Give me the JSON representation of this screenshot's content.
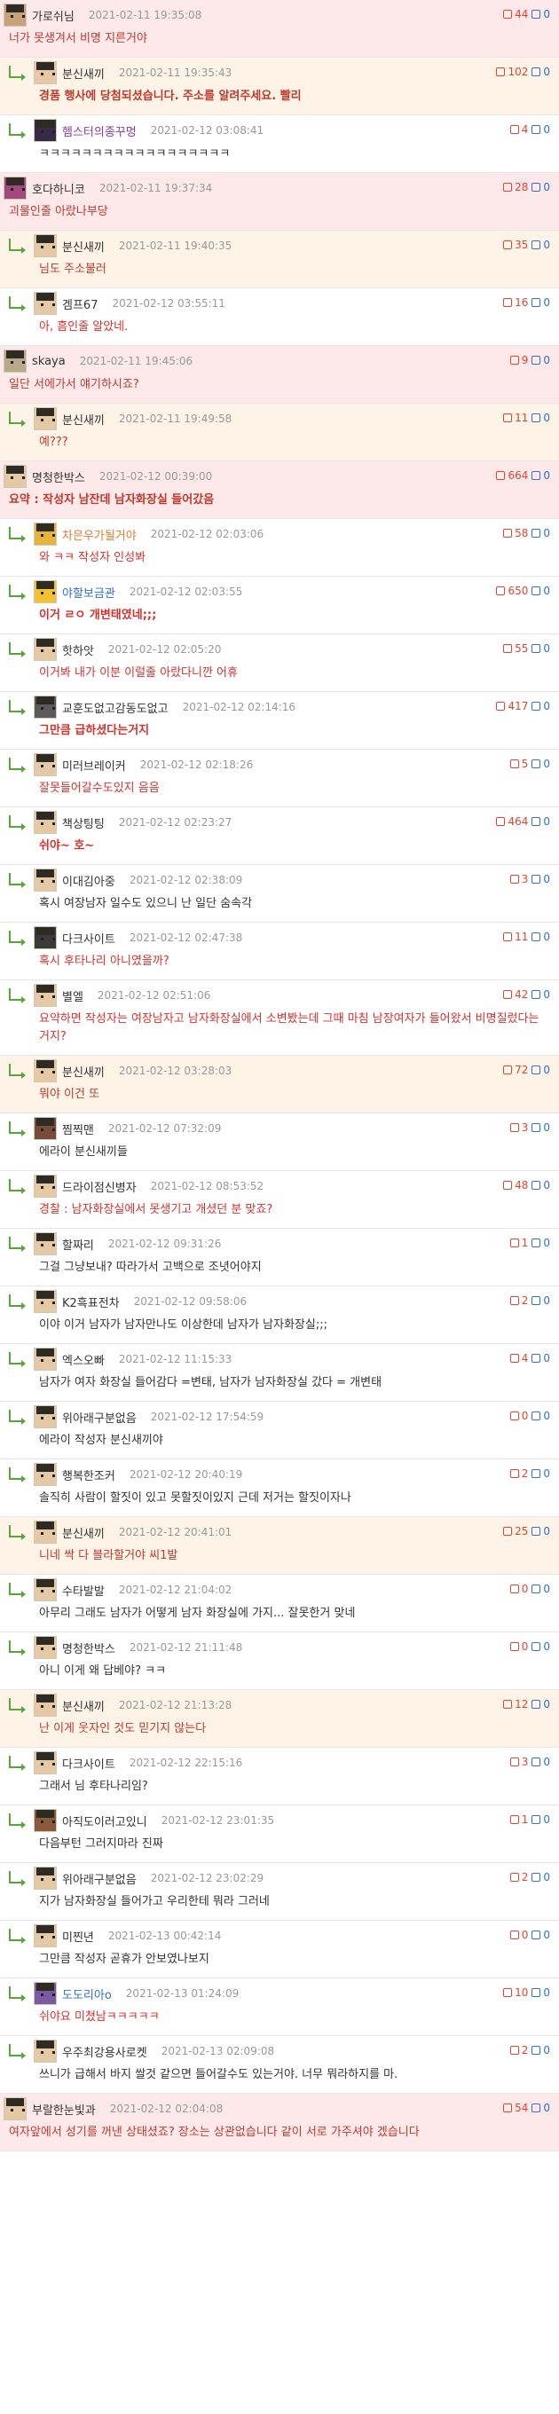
{
  "comments": [
    {
      "type": "best",
      "depth": 0,
      "avatar": "custom",
      "avatar_color": "#c9a27a",
      "nick": "가로쉬님",
      "time": "2021-02-11 19:35:08",
      "up": "44",
      "down": "0",
      "text": "너가 못생겨서 비명 지른거야"
    },
    {
      "type": "author",
      "depth": 1,
      "avatar": "default",
      "nick": "분신새끼",
      "time": "2021-02-11 19:35:43",
      "up": "102",
      "down": "0",
      "text": "경품 행사에 당첨되셨습니다. 주소를 알려주세요. 빨리",
      "bold": true
    },
    {
      "type": "normal",
      "depth": 1,
      "avatar": "custom",
      "avatar_color": "#3a2a4a",
      "nick": "헴스터의종꾸멍",
      "nick_color": "#8b3ba3",
      "time": "2021-02-12 03:08:41",
      "up": "4",
      "down": "0",
      "text": "ㅋㅋㅋㅋㅋㅋㅋㅋㅋㅋㅋㅋㅋㅋㅋㅋㅋㅋ"
    },
    {
      "type": "best",
      "depth": 0,
      "avatar": "custom",
      "avatar_color": "#a3477f",
      "nick": "호다하니코",
      "time": "2021-02-11 19:37:34",
      "up": "28",
      "down": "0",
      "text": "괴물인줄 아랐나부당"
    },
    {
      "type": "author",
      "depth": 1,
      "avatar": "default",
      "nick": "분신새끼",
      "time": "2021-02-11 19:40:35",
      "up": "35",
      "down": "0",
      "text": "님도 주소불러"
    },
    {
      "type": "normal",
      "depth": 1,
      "avatar": "default",
      "nick": "겜프67",
      "time": "2021-02-12 03:55:11",
      "up": "16",
      "down": "0",
      "text": "아, 흠인줄 알았네.",
      "red": true
    },
    {
      "type": "best",
      "depth": 0,
      "avatar": "custom",
      "avatar_color": "#b8a98a",
      "nick": "skaya",
      "time": "2021-02-11 19:45:06",
      "up": "9",
      "down": "0",
      "text": "일단 서에가서 얘기하시죠?"
    },
    {
      "type": "author",
      "depth": 1,
      "avatar": "default",
      "nick": "분신새끼",
      "time": "2021-02-11 19:49:58",
      "up": "11",
      "down": "0",
      "text": "예???"
    },
    {
      "type": "best",
      "depth": 0,
      "avatar": "default",
      "nick": "명청한박스",
      "time": "2021-02-12 00:39:00",
      "up": "664",
      "down": "0",
      "text": "요약 : 작성자 남잔데 남자화장실 들어갔음",
      "bold": true
    },
    {
      "type": "normal",
      "depth": 1,
      "avatar": "custom",
      "avatar_color": "#e6b43a",
      "nick": "차은우가될거야",
      "nick_color": "#e07a2e",
      "time": "2021-02-12 02:03:06",
      "up": "58",
      "down": "0",
      "text": "와 ㅋㅋ 작성자 인성봐",
      "red": true
    },
    {
      "type": "normal",
      "depth": 1,
      "avatar": "custom",
      "avatar_color": "#f2c230",
      "nick": "야할보금관",
      "nick_color": "#2e6fd8",
      "time": "2021-02-12 02:03:55",
      "up": "650",
      "down": "0",
      "text": "이거 ㄹㅇ 개변태였네;;;",
      "red": true,
      "bold": true
    },
    {
      "type": "normal",
      "depth": 1,
      "avatar": "default",
      "nick": "핫하앗",
      "time": "2021-02-12 02:05:20",
      "up": "55",
      "down": "0",
      "text": "이거봐 내가 이분 이럴줄 아랐다니깐 어휴",
      "red": true
    },
    {
      "type": "normal",
      "depth": 1,
      "avatar": "custom",
      "avatar_color": "#5a5a5a",
      "nick": "교훈도없고감동도없고",
      "time": "2021-02-12 02:14:16",
      "up": "417",
      "down": "0",
      "text": "그만큼 급하셨다는거지",
      "red": true,
      "bold": true
    },
    {
      "type": "normal",
      "depth": 1,
      "avatar": "default",
      "nick": "미러브레이커",
      "time": "2021-02-12 02:18:26",
      "up": "5",
      "down": "0",
      "text": "잘못들어갈수도있지 음음",
      "red": true
    },
    {
      "type": "normal",
      "depth": 1,
      "avatar": "default",
      "nick": "책상팅팅",
      "time": "2021-02-12 02:23:27",
      "up": "464",
      "down": "0",
      "text": "쉬야~ 호~",
      "red": true,
      "bold": true
    },
    {
      "type": "normal",
      "depth": 1,
      "avatar": "default",
      "nick": "이대김아중",
      "time": "2021-02-12 02:38:09",
      "up": "3",
      "down": "0",
      "text": "혹시 여장남자 일수도 있으니 난 일단 숨속각"
    },
    {
      "type": "normal",
      "depth": 1,
      "avatar": "custom",
      "avatar_color": "#3a3a3a",
      "nick": "다크사이트",
      "time": "2021-02-12 02:47:38",
      "up": "11",
      "down": "0",
      "text": "혹시 후타나리 아니였을까?",
      "red": true
    },
    {
      "type": "normal",
      "depth": 1,
      "avatar": "default",
      "nick": "별엘",
      "time": "2021-02-12 02:51:06",
      "up": "42",
      "down": "0",
      "text": "요약하면 작성자는 여장남자고 남자화장실에서 소변봤는데 그때 마침 남장여자가 들어왔서 비명질렀다는 거지?",
      "red": true
    },
    {
      "type": "author",
      "depth": 1,
      "avatar": "default",
      "nick": "분신새끼",
      "time": "2021-02-12 03:28:03",
      "up": "72",
      "down": "0",
      "text": "뭐야 이건 또"
    },
    {
      "type": "normal",
      "depth": 1,
      "avatar": "custom",
      "avatar_color": "#7a4a3a",
      "nick": "찜찍맨",
      "time": "2021-02-12 07:32:09",
      "up": "3",
      "down": "0",
      "text": "에라이 분신새끼들"
    },
    {
      "type": "normal",
      "depth": 1,
      "avatar": "default",
      "nick": "드라이점신병자",
      "time": "2021-02-12 08:53:52",
      "up": "48",
      "down": "0",
      "text": "경찰 : 남자화장실에서 못생기고 개셨던 분 맞죠?",
      "red": true
    },
    {
      "type": "normal",
      "depth": 1,
      "avatar": "default",
      "nick": "할짜리",
      "time": "2021-02-12 09:31:26",
      "up": "1",
      "down": "0",
      "text": "그걸 그냥보내? 따라가서 고백으로 조녓어야지"
    },
    {
      "type": "normal",
      "depth": 1,
      "avatar": "default",
      "nick": "K2흑표전차",
      "time": "2021-02-12 09:58:06",
      "up": "2",
      "down": "0",
      "text": "이야 이거 남자가 남자만나도 이상한데 남자가 남자화장실;;;"
    },
    {
      "type": "normal",
      "depth": 1,
      "avatar": "default",
      "nick": "엑스오빠",
      "time": "2021-02-12 11:15:33",
      "up": "4",
      "down": "0",
      "text": "남자가 여자 화장실 들어감다 =변태, 남자가 남자화장실 갔다 = 개변태"
    },
    {
      "type": "normal",
      "depth": 1,
      "avatar": "default",
      "nick": "위아래구분없음",
      "time": "2021-02-12 17:54:59",
      "up": "0",
      "down": "0",
      "text": "에라이 작성자 분신새끼야"
    },
    {
      "type": "normal",
      "depth": 1,
      "avatar": "default",
      "nick": "행복한조커",
      "time": "2021-02-12 20:40:19",
      "up": "2",
      "down": "0",
      "text": "솔직히 사람이 할짓이 있고 못할짓이있지 근데 저거는 할짓이자나"
    },
    {
      "type": "author",
      "depth": 1,
      "avatar": "default",
      "nick": "분신새끼",
      "time": "2021-02-12 20:41:01",
      "up": "25",
      "down": "0",
      "text": "니네 싹 다 블라할거야 씨1발"
    },
    {
      "type": "normal",
      "depth": 1,
      "avatar": "default",
      "nick": "수타발발",
      "time": "2021-02-12 21:04:02",
      "up": "0",
      "down": "0",
      "text": "아무리 그래도 남자가 어떻게 남자 화장실에 가지... 잘못한거 맞네"
    },
    {
      "type": "normal",
      "depth": 1,
      "avatar": "default",
      "nick": "명청한박스",
      "time": "2021-02-12 21:11:48",
      "up": "0",
      "down": "0",
      "text": "아니 이게 왜 답베야? ㅋㅋ"
    },
    {
      "type": "author",
      "depth": 1,
      "avatar": "default",
      "nick": "분신새끼",
      "time": "2021-02-12 21:13:28",
      "up": "12",
      "down": "0",
      "text": "난 이게 웃자인 것도 믿기지 않는다"
    },
    {
      "type": "normal",
      "depth": 1,
      "avatar": "default",
      "nick": "다크사이트",
      "time": "2021-02-12 22:15:16",
      "up": "3",
      "down": "0",
      "text": "그래서 님 후타나리임?"
    },
    {
      "type": "normal",
      "depth": 1,
      "avatar": "custom",
      "avatar_color": "#8a5a3a",
      "nick": "아직도이러고있니",
      "time": "2021-02-12 23:01:35",
      "up": "1",
      "down": "0",
      "text": "다음부턴 그러지마라 진짜"
    },
    {
      "type": "normal",
      "depth": 1,
      "avatar": "default",
      "nick": "위아래구분없음",
      "time": "2021-02-12 23:02:29",
      "up": "2",
      "down": "0",
      "text": "지가 남자화장실 들어가고 우리한테 뭐라 그러네"
    },
    {
      "type": "normal",
      "depth": 1,
      "avatar": "default",
      "nick": "미찐년",
      "time": "2021-02-13 00:42:14",
      "up": "0",
      "down": "0",
      "text": "그만큼 작성자 곧휴가 안보였나보지"
    },
    {
      "type": "normal",
      "depth": 1,
      "avatar": "custom",
      "avatar_color": "#7a5aa0",
      "nick": "도도리아o",
      "nick_color": "#2e6fd8",
      "time": "2021-02-13 01:24:09",
      "up": "10",
      "down": "0",
      "text": "쉬야요 미쳤남ㅋㅋㅋㅋㅋ",
      "red": true
    },
    {
      "type": "normal",
      "depth": 1,
      "avatar": "default",
      "nick": "우주최강용사로켓",
      "time": "2021-02-13 02:09:08",
      "up": "2",
      "down": "0",
      "text": "쓰니가 급해서 바지 쌀것 같으면 들어갈수도 있는거야. 너무 뭐라하지를 마."
    },
    {
      "type": "best",
      "depth": 0,
      "avatar": "default",
      "nick": "부랄한눈빛과",
      "time": "2021-02-12 02:04:08",
      "up": "54",
      "down": "0",
      "text": "여자앞에서 성기를 꺼낸 상태셨죠? 장소는 상관없습니다 같이 서로 가주셔야 겠습니다"
    }
  ]
}
